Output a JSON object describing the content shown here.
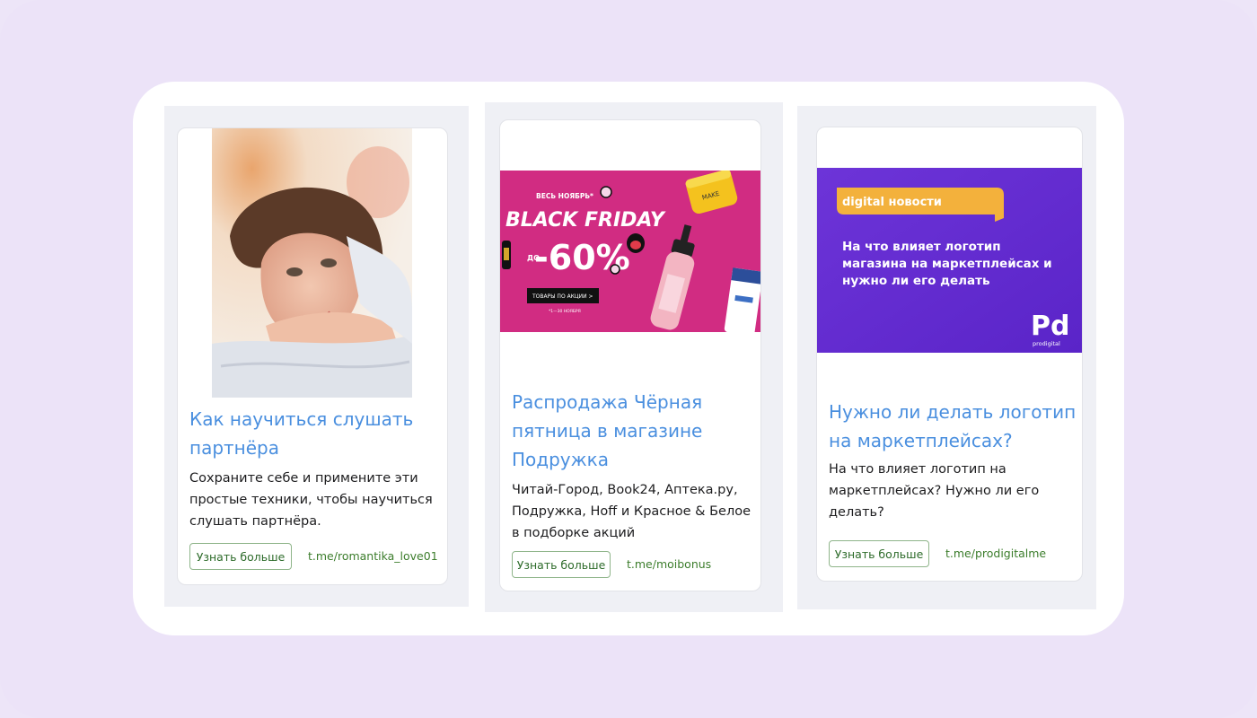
{
  "cards": [
    {
      "title": "Как научиться слушать партнёра",
      "description": "Сохраните себе и примените эти простые техники, чтобы научиться слушать партнёра.",
      "button_label": "Узнать больше",
      "link": "t.me/romantika_love01",
      "image": "watercolor-portrait-woman"
    },
    {
      "title": "Распродажа Чёрная пятница в магазине Подружка",
      "description": "Читай-Город, Book24, Аптека.ру, Подружка, Hoff и Красное & Белое в подборке акций",
      "button_label": "Узнать больше",
      "link": "t.me/moibonus",
      "image": "black-friday-banner",
      "banner": {
        "top_label": "ВЕСЬ НОЯБРЬ*",
        "headline": "BLACK FRIDAY",
        "prefix": "ДО",
        "discount": "-60%",
        "cta": "ТОВАРЫ ПО АКЦИИ >",
        "footnote": "*1—30 НОЯБРЯ",
        "jar_label": "MAKE"
      }
    },
    {
      "title": "Нужно ли делать логотип на маркетплейсах?",
      "description": "На что влияет логотип на маркетплейсах? Нужно ли его делать?",
      "button_label": "Узнать больше",
      "link": "t.me/prodigitalme",
      "image": "digital-news-banner",
      "banner": {
        "tag": "digital новости",
        "text": "На что влияет логотип магазина на маркетплейсах и нужно ли его делать",
        "logo": "Pd",
        "logo_caption": "prodigital"
      }
    }
  ],
  "colors": {
    "background": "#ece3f8",
    "title": "#4a8fdf",
    "link": "#3c7d2c",
    "banner_pink": "#d12c82",
    "banner_purple": "#6930d6",
    "tag_orange": "#f3b13c"
  }
}
